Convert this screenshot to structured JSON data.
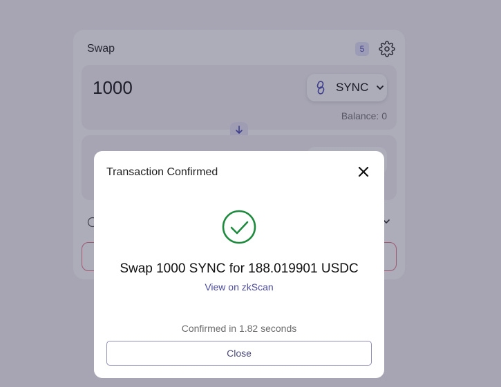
{
  "swap": {
    "title": "Swap",
    "slippage_badge": "5",
    "input": {
      "amount": "1000",
      "token": "SYNC",
      "balance": "Balance: 0"
    }
  },
  "modal": {
    "title": "Transaction Confirmed",
    "summary": "Swap 1000 SYNC for 188.019901 USDC",
    "view_link": "View on zkScan",
    "confirmed_time": "Confirmed in 1.82 seconds",
    "close_button": "Close"
  },
  "colors": {
    "success": "#1e8a3e",
    "accent": "#4b4cb6",
    "error_border": "#e87a8c"
  },
  "icons": {
    "settings": "gear-icon",
    "token": "sync-token-icon",
    "dropdown": "chevron-down-icon",
    "switch": "arrow-down-icon",
    "close": "close-icon",
    "success": "check-circle-icon"
  }
}
